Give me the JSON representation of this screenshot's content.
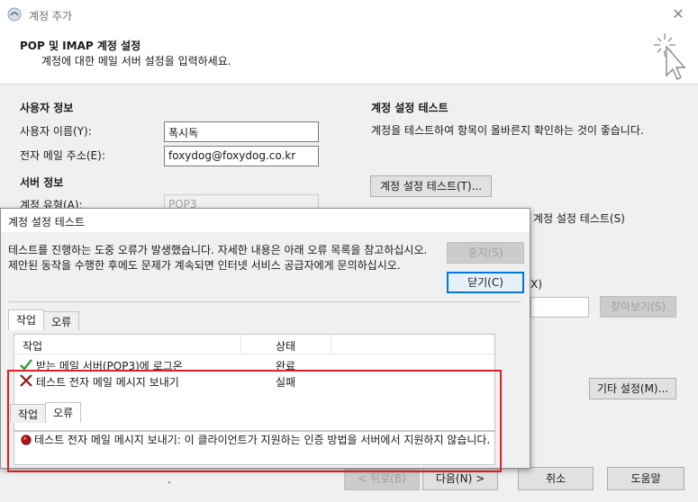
{
  "window": {
    "title": "계정 추가"
  },
  "header": {
    "title": "POP 및 IMAP 계정 설정",
    "subtitle": "계정에 대한 메일 서버 설정을 입력하세요."
  },
  "user_info": {
    "section_title": "사용자 정보",
    "name_label": "사용자 이름(Y):",
    "name_value": "폭시독",
    "email_label": "전자 메일 주소(E):",
    "email_value": "foxydog@foxydog.co.kr"
  },
  "server_info": {
    "section_title": "서버 정보",
    "account_type_label": "계정 유형(A):",
    "account_type_value": "POP3"
  },
  "test_settings": {
    "section_title": "계정 설정 테스트",
    "description": "계정을 테스트하여 항목이 올바른지 확인하는 것이 좋습니다.",
    "test_button": "계정 설정 테스트(T)...",
    "auto_test_label": "계정 설정 테스트(S)",
    "partial_label_x": "X)",
    "browse_button": "찾아보기(S)",
    "more_settings_button": "기타 설정(M)..."
  },
  "footer": {
    "back_button": "< 뒤로(B)",
    "next_button": "다음(N) >",
    "cancel_button": "취소",
    "help_button": "도움말",
    "dot": "."
  },
  "dialog": {
    "title": "계정 설정 테스트",
    "message": "테스트를 진행하는 도중 오류가 발생했습니다. 자세한 내용은 아래 오류 목록을 참고하십시오. 제안된 동작을 수행한 후에도 문제가 계속되면 인터넷 서비스 공급자에게 문의하십시오.",
    "stop_button": "중지(S)",
    "close_button": "닫기(C)",
    "tabs": [
      "작업",
      "오류"
    ],
    "columns": {
      "task": "작업",
      "status": "상태"
    },
    "tasks": [
      {
        "name": "받는 메일 서버(POP3)에 로그온",
        "status": "완료",
        "result_icon": "check-icon"
      },
      {
        "name": "테스트 전자 메일 메시지 보내기",
        "status": "실패",
        "result_icon": "x-icon"
      }
    ],
    "lower_tabs": [
      "작업",
      "오류"
    ],
    "error_message": "테스트 전자 메일 메시지 보내기: 이 클라이언트가 지원하는 인증 방법을 서버에서 지원하지 않습니다."
  },
  "colors": {
    "highlight": "#e51b23",
    "focus_blue": "#0078d7",
    "check_green": "#2e9b2e",
    "x_red": "#8b1a1a"
  }
}
